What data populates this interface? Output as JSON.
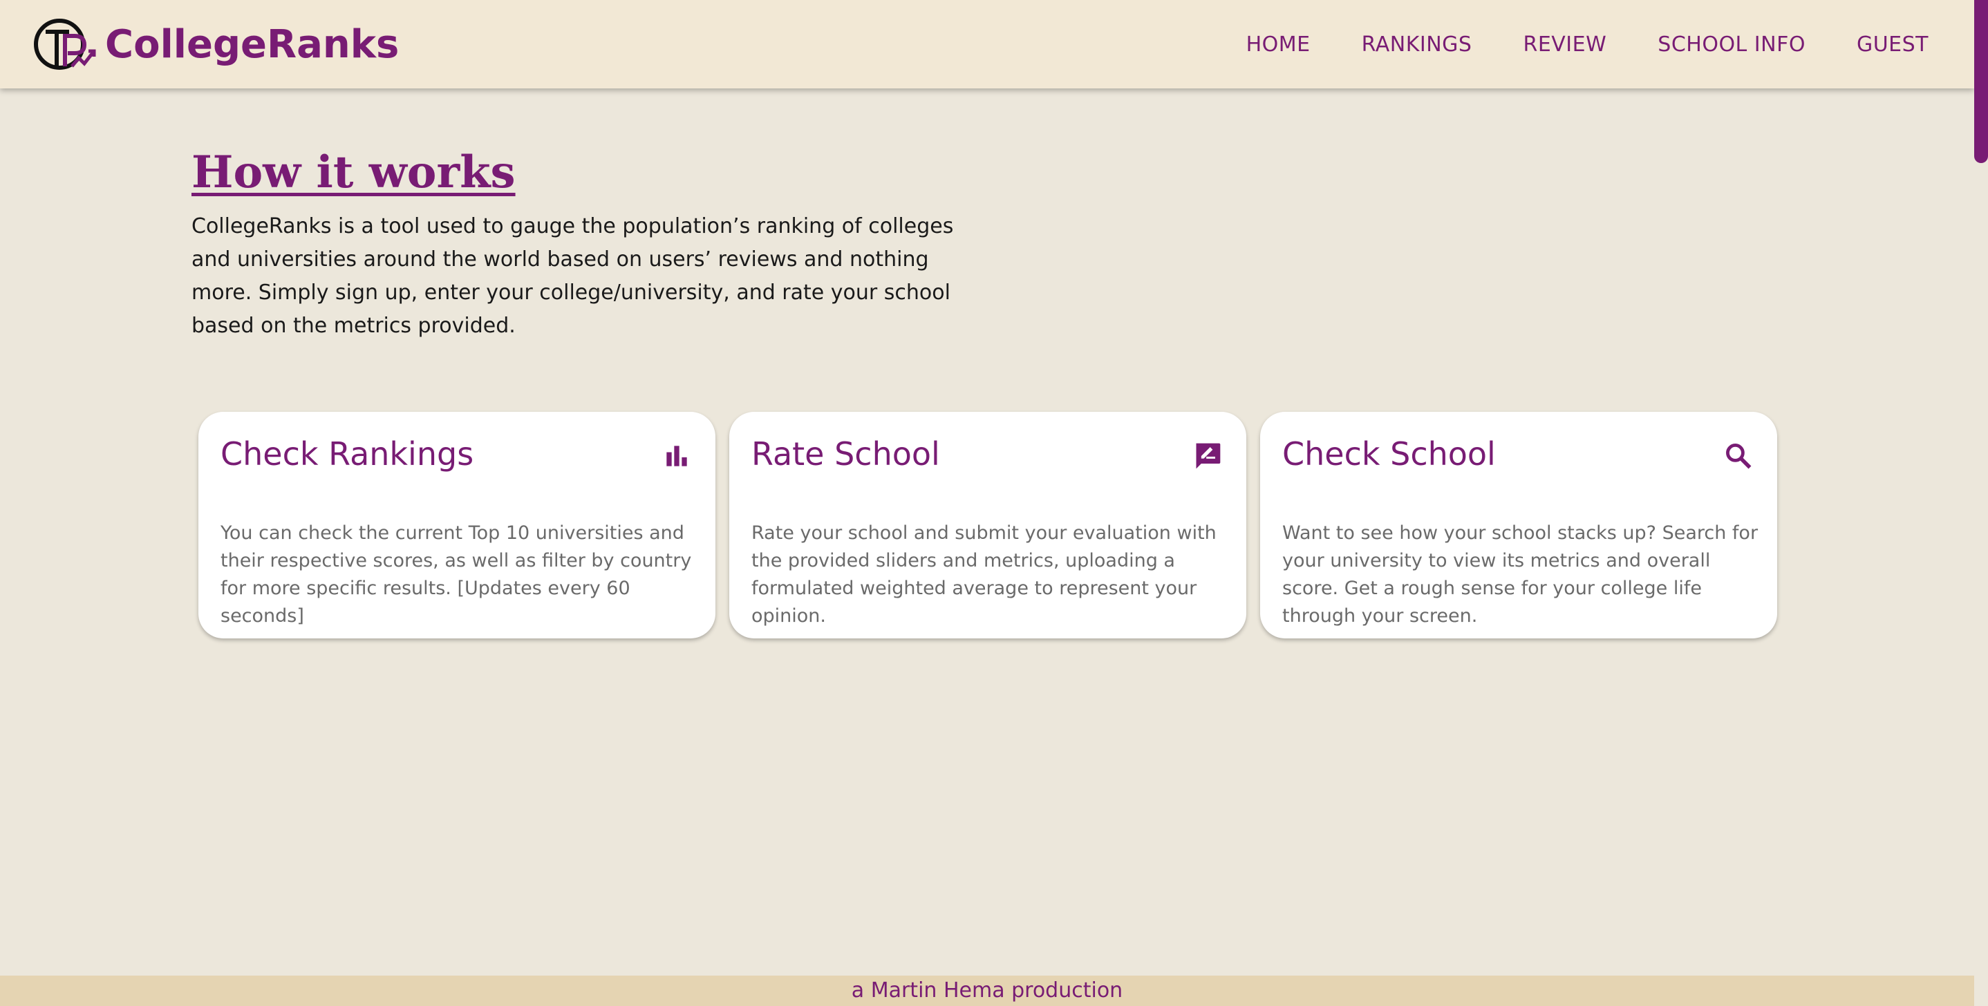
{
  "brand": {
    "name": "CollegeRanks",
    "color": "#781c74"
  },
  "nav": {
    "items": [
      "HOME",
      "RANKINGS",
      "REVIEW",
      "SCHOOL INFO",
      "GUEST"
    ]
  },
  "intro": {
    "heading": "How it works",
    "body": "CollegeRanks is a tool used to gauge the population’s ranking of colleges and universities around the world based on users’ reviews and nothing more. Simply sign up, enter your college/university, and rate your school based on the metrics provided."
  },
  "cards": [
    {
      "title": "Check Rankings",
      "icon": "bar-chart-icon",
      "text": "You can check the current Top 10 universities and their respective scores, as well as filter by country for more specific results. [Updates every 60 seconds]"
    },
    {
      "title": "Rate School",
      "icon": "rate-review-icon",
      "text": "Rate your school and submit your evaluation with the provided sliders and metrics, uploading a formulated weighted average to represent your opinion."
    },
    {
      "title": "Check School",
      "icon": "search-icon",
      "text": "Want to see how your school stacks up? Search for your university to view its metrics and overall score. Get a rough sense for your college life through your screen."
    }
  ],
  "footer": {
    "text": "a Martin Hema production"
  },
  "colors": {
    "background": "#ece7db",
    "navbar": "#f2e8d5",
    "accent": "#781c74",
    "footer": "#e5d4b2"
  }
}
